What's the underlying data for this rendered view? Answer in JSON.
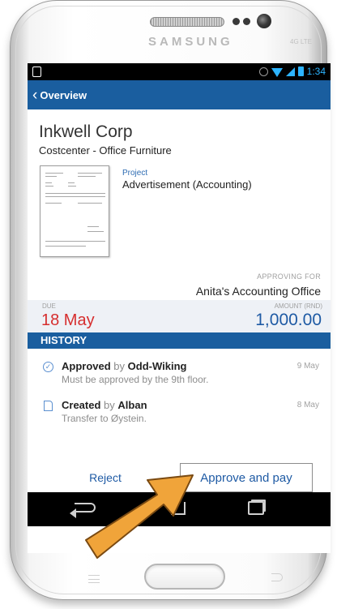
{
  "device": {
    "brand": "SAMSUNG",
    "network_badge": "4G LTE"
  },
  "status_bar": {
    "time": "1:34"
  },
  "app_bar": {
    "back_label": "Overview"
  },
  "invoice": {
    "company": "Inkwell Corp",
    "costcenter": "Costcenter - Office Furniture",
    "project_label": "Project",
    "project_value": "Advertisement (Accounting)",
    "approving_for_label": "APPROVING FOR",
    "approving_for_value": "Anita's Accounting Office",
    "due_label": "DUE",
    "due_value": "18 May",
    "amount_label": "AMOUNT (RND)",
    "amount_value": "1,000.00"
  },
  "history": {
    "header": "HISTORY",
    "items": [
      {
        "icon": "check-circle-icon",
        "action": "Approved",
        "by": "by",
        "person": "Odd-Wiking",
        "date": "9 May",
        "note": "Must be approved by the 9th floor."
      },
      {
        "icon": "document-icon",
        "action": "Created",
        "by": "by",
        "person": "Alban",
        "date": "8 May",
        "note": "Transfer to Øystein."
      }
    ]
  },
  "actions": {
    "reject_label": "Reject",
    "approve_label": "Approve and pay"
  },
  "colors": {
    "accent": "#1a5e9f",
    "due": "#d62e2e",
    "amount": "#1e5aa4",
    "arrow": "#f0a43a"
  }
}
